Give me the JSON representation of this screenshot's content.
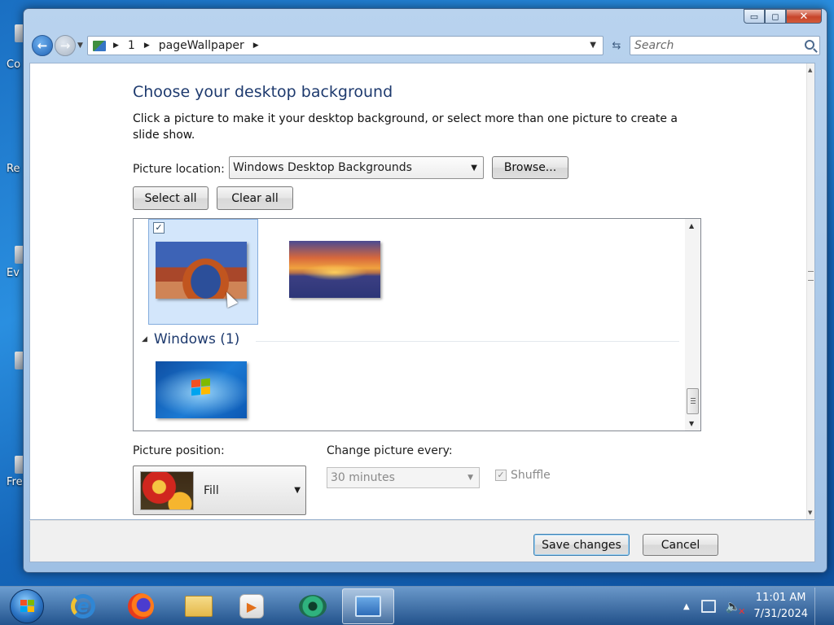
{
  "desktop": {
    "icon_labels": [
      "Co",
      "Re",
      "Ev",
      "Fre"
    ]
  },
  "window": {
    "controls": {
      "minimize": "▭",
      "maximize": "◻",
      "close": "✕"
    }
  },
  "address_bar": {
    "crumbs": [
      "1",
      "pageWallpaper"
    ],
    "separator": "▶",
    "search_placeholder": "Search",
    "refresh_icon": "⇆"
  },
  "page": {
    "title": "Choose your desktop background",
    "description": "Click a picture to make it your desktop background, or select more than one picture to create a slide show.",
    "location_label": "Picture location:",
    "location_value": "Windows Desktop Backgrounds",
    "browse_label": "Browse...",
    "select_all_label": "Select all",
    "clear_all_label": "Clear all"
  },
  "gallery": {
    "items": [
      {
        "name": "arch",
        "selected": true
      },
      {
        "name": "lake-sunset",
        "selected": false
      },
      {
        "name": "windows-7",
        "selected": false
      }
    ],
    "group_label": "Windows (1)",
    "check_mark": "✓"
  },
  "position": {
    "label": "Picture position:",
    "value": "Fill"
  },
  "slideshow": {
    "label": "Change picture every:",
    "value": "30 minutes",
    "shuffle_label": "Shuffle",
    "shuffle_checked": true
  },
  "actions": {
    "save_label": "Save changes",
    "cancel_label": "Cancel"
  },
  "taskbar": {
    "apps": [
      "internet-explorer",
      "firefox",
      "windows-explorer",
      "media-player",
      "eye-app",
      "control-panel"
    ],
    "active_app": "control-panel",
    "clock_time": "11:01 AM",
    "clock_date": "7/31/2024",
    "ie_glyph": "e",
    "media_glyph": "▶"
  },
  "colors": {
    "title": "#1e3a6e",
    "selection": "#d3e6fb",
    "desktop": "#1a6fc2"
  }
}
